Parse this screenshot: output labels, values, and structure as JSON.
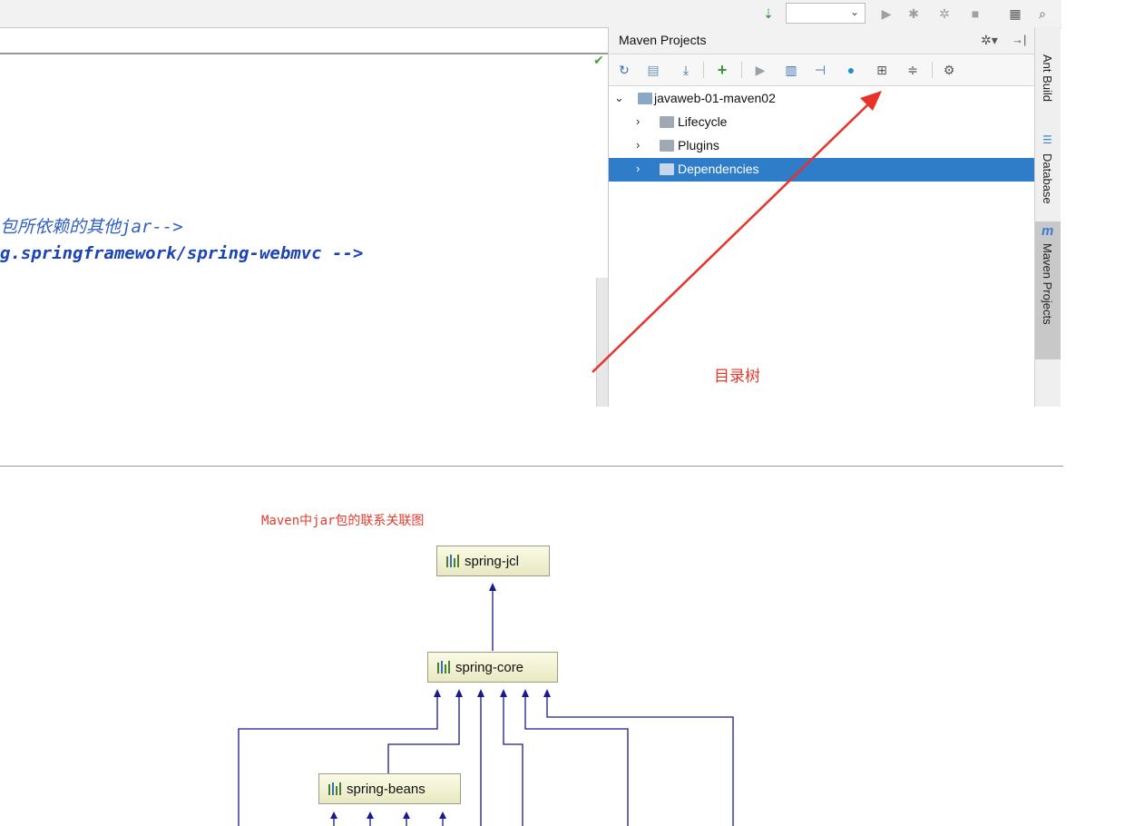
{
  "toolbar": {
    "icons": [
      "sort-numeric-icon",
      "run-icon",
      "debug-icon",
      "coverage-icon",
      "stop-icon",
      "project-structure-icon",
      "search-icon"
    ]
  },
  "editor": {
    "lines": [
      "包所依赖的其他jar-->",
      "g.springframework/spring-webmvc -->"
    ]
  },
  "maven": {
    "title": "Maven Projects",
    "toolbar_icons": [
      "reimport-icon",
      "generate-sources-icon",
      "download-icon",
      "add-icon",
      "run-icon",
      "execute-goal-icon",
      "toggle-offline-icon",
      "skip-tests-icon",
      "show-dependencies-icon",
      "collapse-all-icon",
      "settings-icon"
    ],
    "tree": [
      {
        "label": "javaweb-01-maven02",
        "expanded": true
      },
      {
        "label": "Lifecycle",
        "expanded": false
      },
      {
        "label": "Plugins",
        "expanded": false
      },
      {
        "label": "Dependencies",
        "expanded": false,
        "selected": true
      }
    ]
  },
  "side_tabs": [
    "Ant Build",
    "Database",
    "Maven Projects"
  ],
  "annotation": "目录树",
  "diagram": {
    "title": "Maven中jar包的联系关联图",
    "nodes": [
      "spring-jcl",
      "spring-core",
      "spring-beans"
    ]
  },
  "colors": {
    "selection": "#2f7cc9",
    "annotation_red": "#e23b2e",
    "code_blue": "#2f5fbf",
    "diagram_line": "#1a1a8c"
  }
}
